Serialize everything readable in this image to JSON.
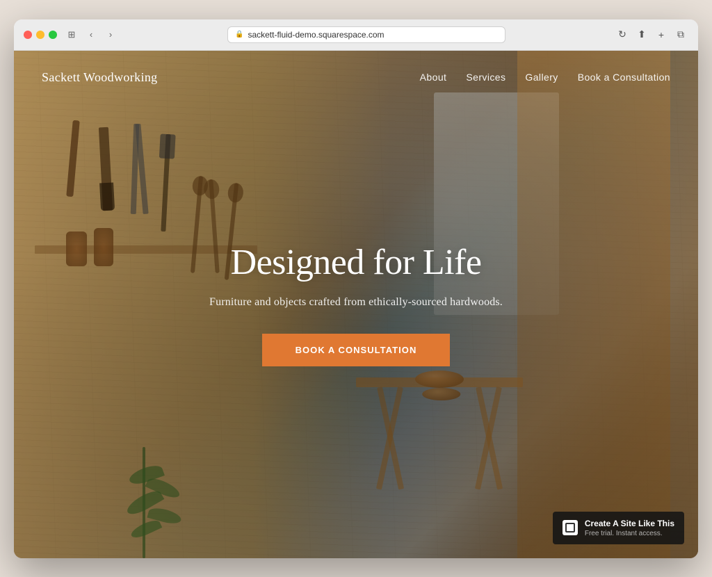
{
  "browser": {
    "url": "sackett-fluid-demo.squarespace.com",
    "reload_label": "↻",
    "back_label": "‹",
    "forward_label": "›",
    "share_label": "⬆",
    "add_tab_label": "+",
    "tabs_label": "⧉",
    "sidebar_label": "⊞"
  },
  "nav": {
    "brand": "Sackett Woodworking",
    "links": [
      {
        "label": "About",
        "id": "about"
      },
      {
        "label": "Services",
        "id": "services"
      },
      {
        "label": "Gallery",
        "id": "gallery"
      },
      {
        "label": "Book a Consultation",
        "id": "book"
      }
    ]
  },
  "hero": {
    "title": "Designed for Life",
    "subtitle": "Furniture and objects crafted from ethically-sourced hardwoods.",
    "cta_label": "Book a Consultation"
  },
  "badge": {
    "headline": "Create A Site Like This",
    "subtext": "Free trial. Instant access."
  }
}
